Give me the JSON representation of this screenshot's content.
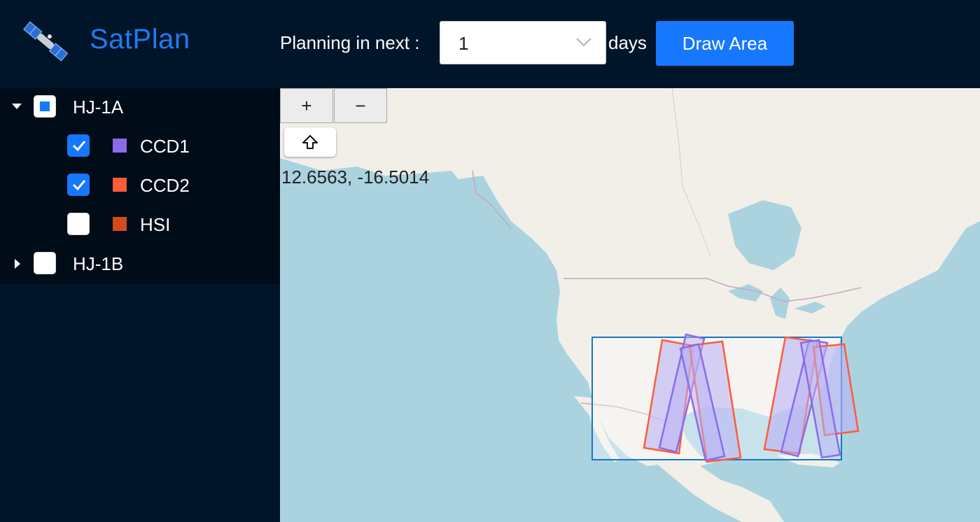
{
  "header": {
    "app_title": "SatPlan",
    "planning_label": "Planning in next :",
    "days_value": "1",
    "days_label": "days",
    "draw_area_label": "Draw Area"
  },
  "sidebar": {
    "tree": [
      {
        "label": "HJ-1A",
        "expanded": true,
        "state": "indeterminate",
        "children": [
          {
            "label": "CCD1",
            "checked": true,
            "color": "#8b6bea"
          },
          {
            "label": "CCD2",
            "checked": true,
            "color": "#ff5c39"
          },
          {
            "label": "HSI",
            "checked": false,
            "color": "#d44a1a"
          }
        ]
      },
      {
        "label": "HJ-1B",
        "expanded": false,
        "state": "unchecked",
        "children": []
      }
    ]
  },
  "map": {
    "zoom_in_label": "+",
    "zoom_out_label": "−",
    "home_icon": "arrow-up-icon",
    "coordinates": "12.6563, -16.5014",
    "colors": {
      "ocean": "#aad3df",
      "land": "#f2efe9",
      "selection_border": "#1677c8",
      "ccd1": "#8b6bea",
      "ccd2": "#ff5c39"
    }
  }
}
